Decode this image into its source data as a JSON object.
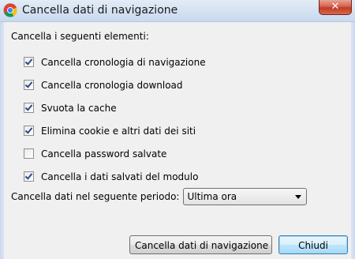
{
  "window": {
    "title": "Cancella dati di navigazione",
    "close_glyph": "✕",
    "icon": "chrome-icon"
  },
  "section": {
    "heading": "Cancella i seguenti elementi:"
  },
  "items": [
    {
      "label": "Cancella cronologia di navigazione",
      "checked": true
    },
    {
      "label": "Cancella cronologia download",
      "checked": true
    },
    {
      "label": "Svuota la cache",
      "checked": true
    },
    {
      "label": "Elimina cookie e altri dati dei siti",
      "checked": true
    },
    {
      "label": "Cancella password salvate",
      "checked": false
    },
    {
      "label": "Cancella i dati salvati del modulo",
      "checked": true
    }
  ],
  "period": {
    "label": "Cancella dati nel seguente periodo:",
    "selected": "Ultima ora"
  },
  "buttons": {
    "clear_label": "Cancella dati di navigazione",
    "close_label": "Chiudi"
  },
  "colors": {
    "titlebar": "#d6e3f2",
    "close_button": "#c23a22",
    "checkmark": "#2c4a8a",
    "default_button_border": "#3c7fb1"
  }
}
